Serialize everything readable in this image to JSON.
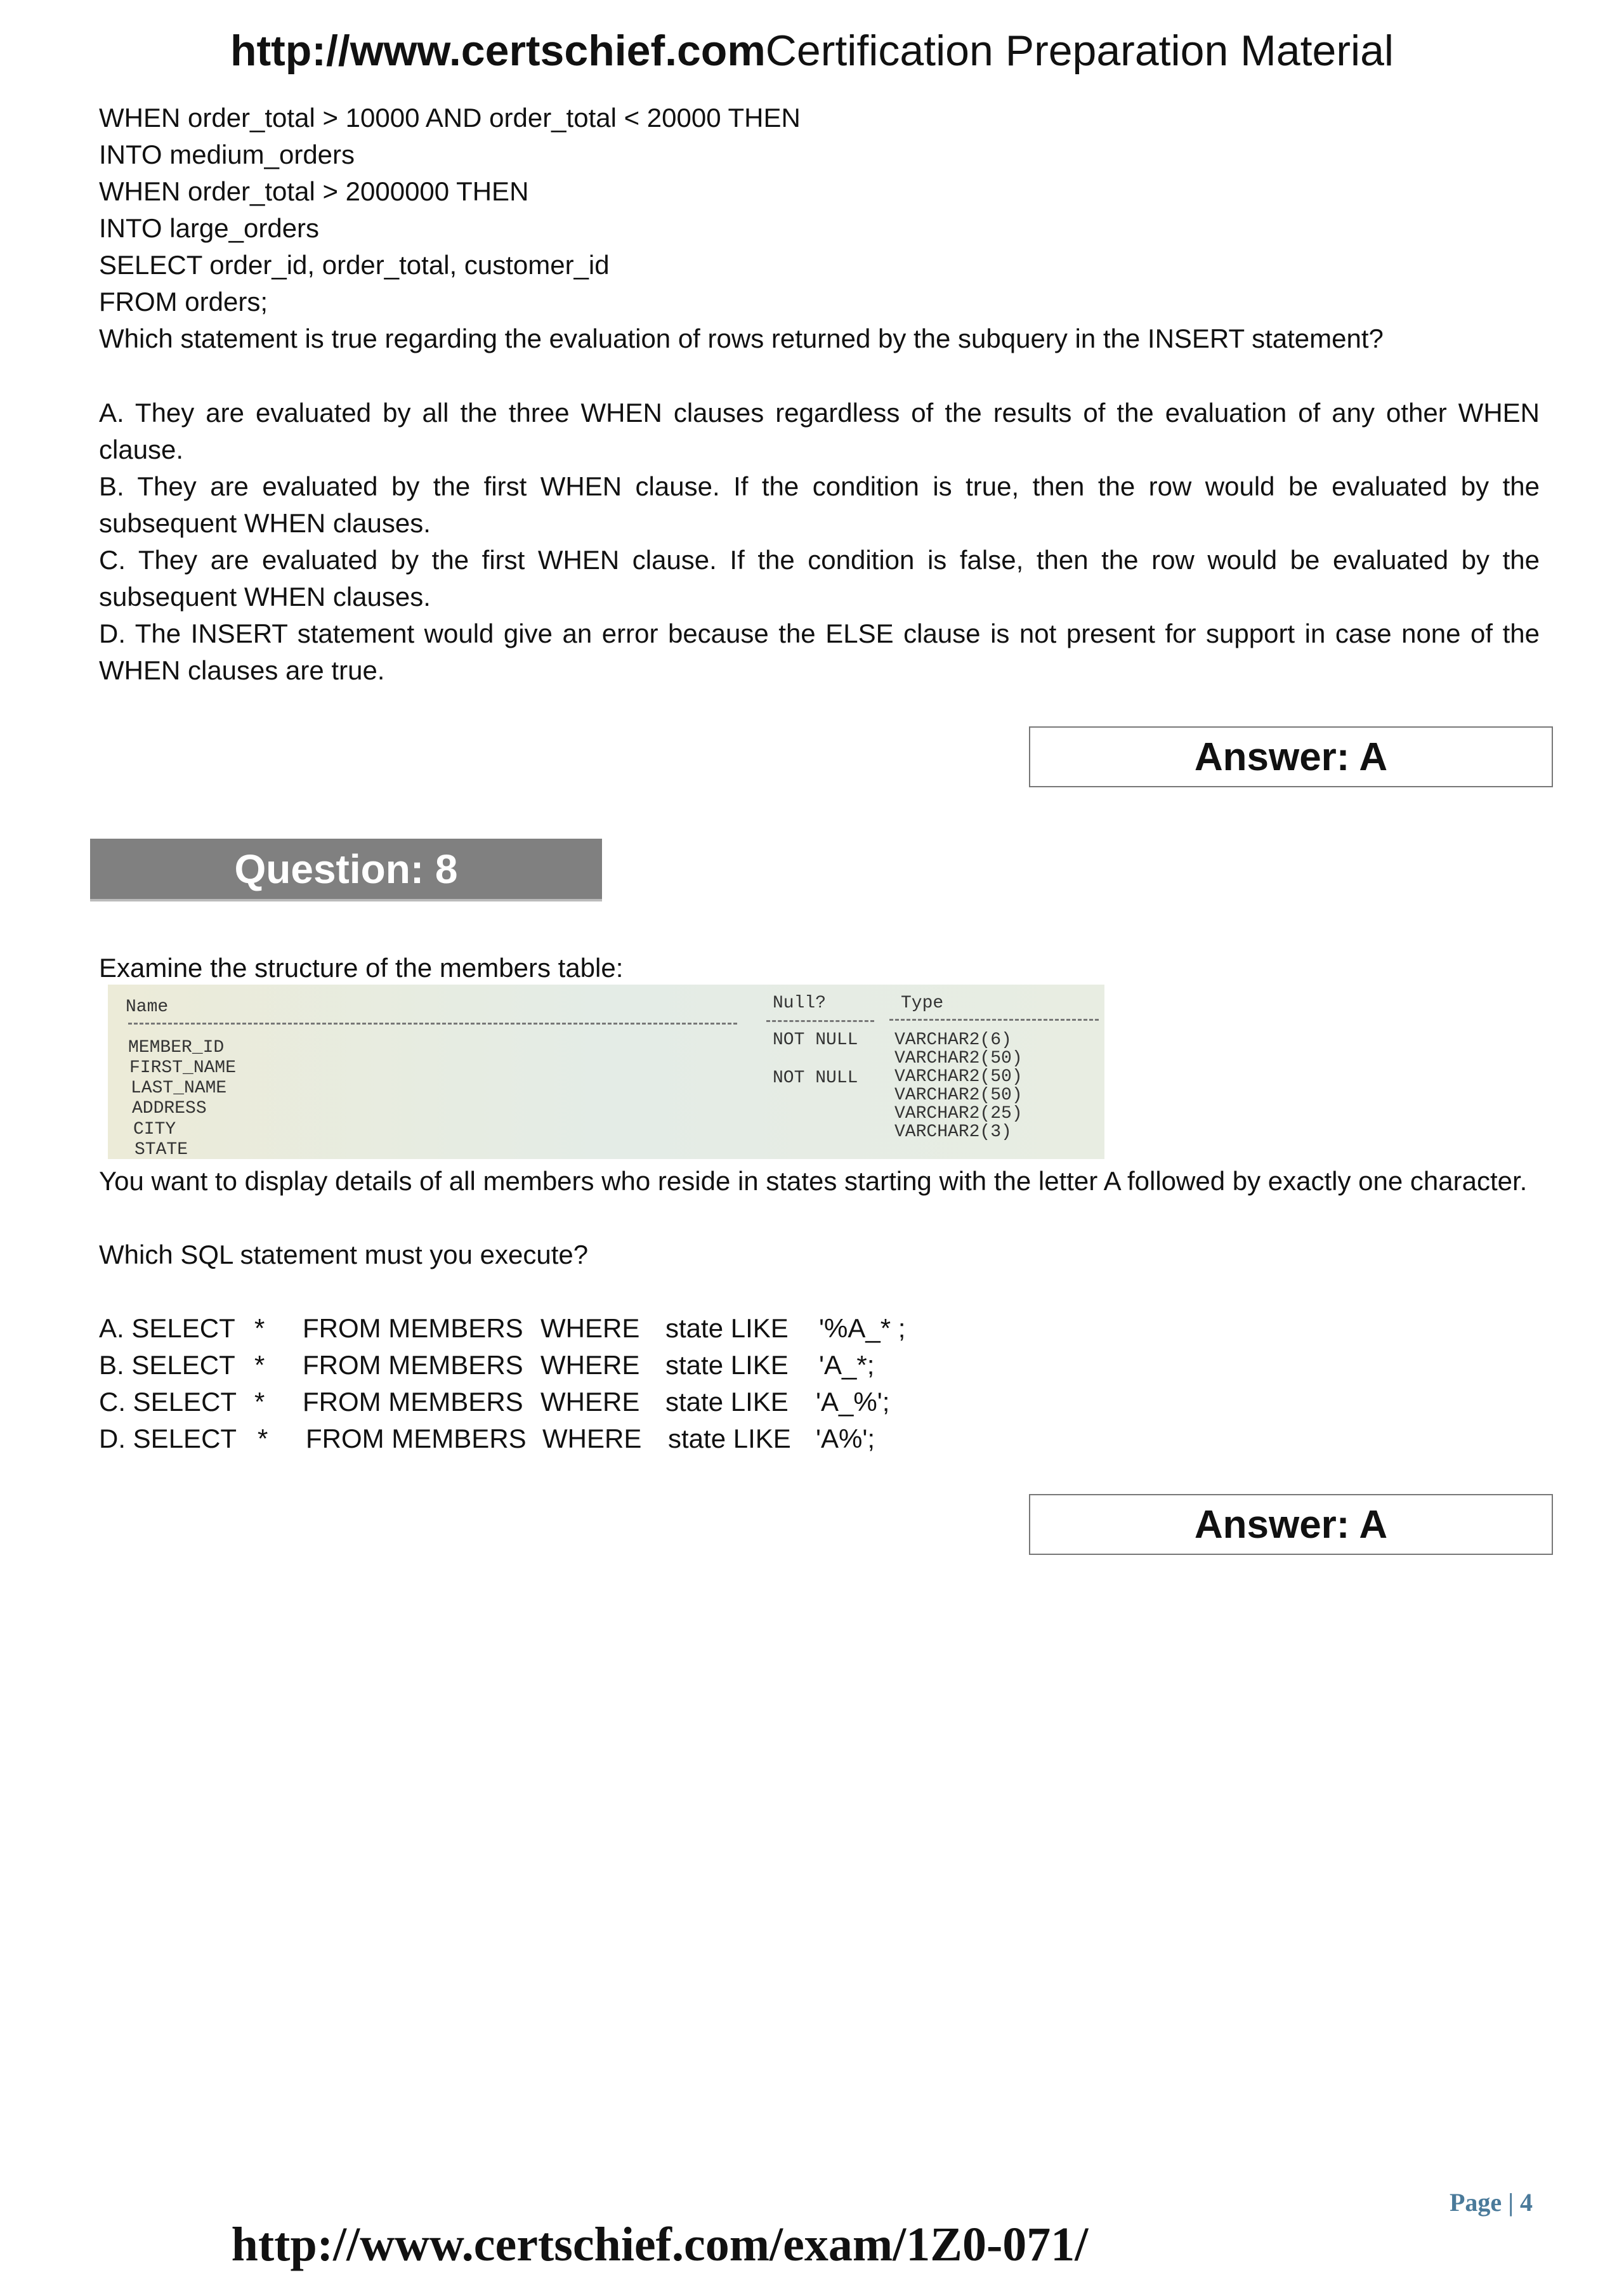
{
  "header": {
    "site": "http://www.certschief.com",
    "tagline": "Certification Preparation Material"
  },
  "prev_question": {
    "code_lines": [
      "WHEN order_total > 10000 AND order_total < 20000 THEN",
      "INTO medium_orders",
      "WHEN order_total > 2000000 THEN",
      "INTO large_orders",
      "SELECT order_id, order_total, customer_id",
      "FROM orders;"
    ],
    "question": "Which statement is true regarding the evaluation of rows returned by the subquery in the INSERT statement?",
    "options": [
      "A. They are evaluated by all the three WHEN clauses regardless of the results of the evaluation of any other WHEN clause.",
      "B. They are evaluated by the first WHEN clause. If the condition is true, then the row would be evaluated by the subsequent WHEN clauses.",
      "C. They are evaluated by the first WHEN clause. If the condition is false, then the row would be evaluated by the subsequent WHEN clauses.",
      "D. The INSERT statement would give an error because the ELSE clause is not present for support in case none of the WHEN clauses are true."
    ],
    "answer": "Answer: A"
  },
  "question8": {
    "title": "Question: 8",
    "intro": "Examine the structure of the members table:",
    "table": {
      "headers": [
        "Name",
        "Null?",
        "Type"
      ],
      "rows": [
        [
          "MEMBER_ID",
          "NOT NULL",
          "VARCHAR2(6)"
        ],
        [
          "FIRST_NAME",
          "",
          "VARCHAR2(50)"
        ],
        [
          "LAST_NAME",
          "NOT NULL",
          "VARCHAR2(50)"
        ],
        [
          "ADDRESS",
          "",
          "VARCHAR2(50)"
        ],
        [
          "CITY",
          "",
          "VARCHAR2(25)"
        ],
        [
          "STATE",
          "",
          "VARCHAR2(3)"
        ]
      ]
    },
    "text1": "You want to display details of all members who reside in states starting with the letter A followed by exactly one character.",
    "text2": "Which SQL statement must you execute?",
    "options": [
      [
        "A. SELECT",
        "*",
        "FROM MEMBERS",
        "WHERE",
        "state LIKE",
        "'%A_* ;"
      ],
      [
        "B. SELECT",
        "*",
        "FROM MEMBERS",
        "WHERE",
        "state LIKE",
        "'A_*;"
      ],
      [
        "C. SELECT",
        "*",
        "FROM MEMBERS",
        "WHERE",
        "state LIKE",
        "'A_%';"
      ],
      [
        "D. SELECT",
        "*",
        "FROM MEMBERS",
        "WHERE",
        "state LIKE",
        "'A%';"
      ]
    ],
    "answer": "Answer: A"
  },
  "footer": {
    "page": "Page | 4",
    "url": "http://www.certschief.com/exam/1Z0-071/"
  },
  "colors": {
    "question_bar": "#808080",
    "page_number": "#4a7a9a"
  }
}
